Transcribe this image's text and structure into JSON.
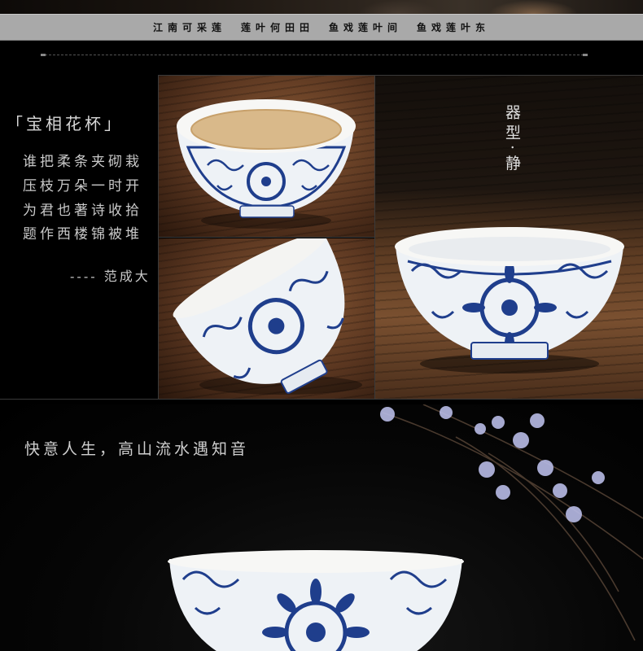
{
  "banner": {
    "text": "江南可采莲　莲叶何田田　鱼戏莲叶间　鱼戏莲叶东"
  },
  "poem": {
    "title": "「宝相花杯」",
    "lines": [
      "谁把柔条夹砌栽",
      "压枝万朵一时开",
      "为君也著诗收拾",
      "题作西楼锦被堆"
    ],
    "author": "---- 范成大"
  },
  "cup_caption": {
    "text": "器型·静"
  },
  "bottom": {
    "slogan": "快意人生，高山流水遇知音"
  },
  "colors": {
    "banner_bg": "#a9a9a9",
    "background": "#000000",
    "porcelain_blue": "#1f3e8c",
    "wood": "#6b4328"
  }
}
